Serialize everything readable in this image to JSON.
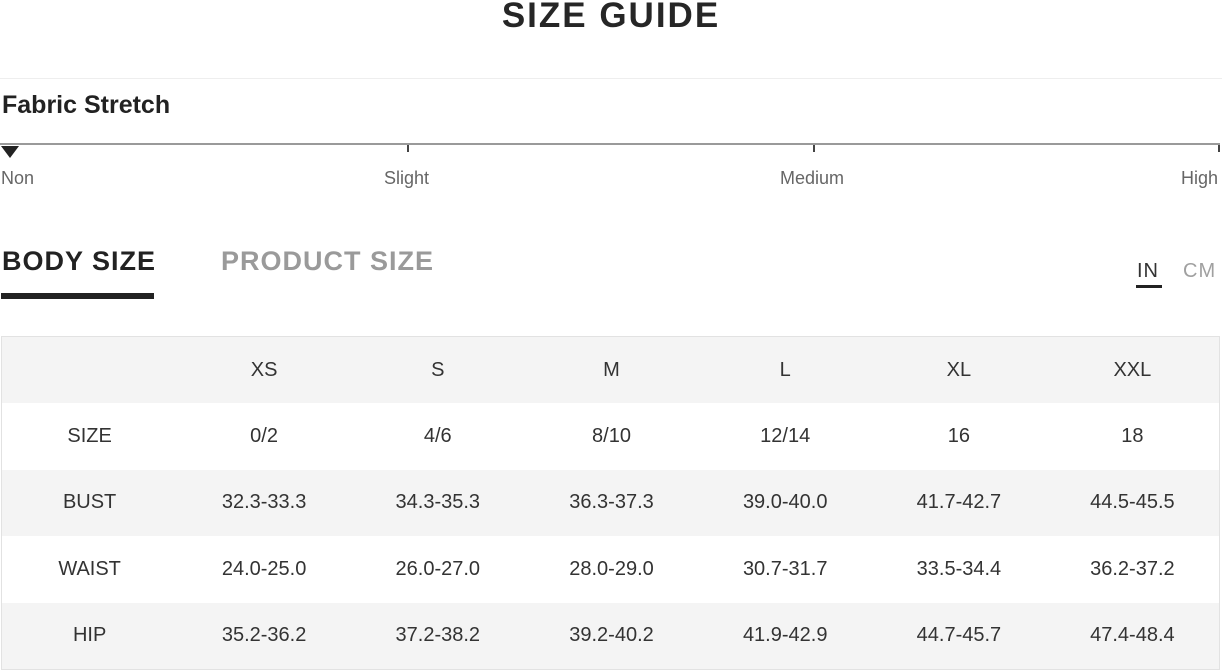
{
  "title": "SIZE GUIDE",
  "fabric_stretch": {
    "heading": "Fabric Stretch",
    "levels": [
      "Non",
      "Slight",
      "Medium",
      "High"
    ],
    "selected": "Non"
  },
  "tabs": {
    "body_size": "BODY SIZE",
    "product_size": "PRODUCT SIZE",
    "active": "BODY SIZE"
  },
  "units": {
    "in": "IN",
    "cm": "CM",
    "active": "IN"
  },
  "table": {
    "columns": [
      "",
      "XS",
      "S",
      "M",
      "L",
      "XL",
      "XXL"
    ],
    "rows": [
      [
        "SIZE",
        "0/2",
        "4/6",
        "8/10",
        "12/14",
        "16",
        "18"
      ],
      [
        "BUST",
        "32.3-33.3",
        "34.3-35.3",
        "36.3-37.3",
        "39.0-40.0",
        "41.7-42.7",
        "44.5-45.5"
      ],
      [
        "WAIST",
        "24.0-25.0",
        "26.0-27.0",
        "28.0-29.0",
        "30.7-31.7",
        "33.5-34.4",
        "36.2-37.2"
      ],
      [
        "HIP",
        "35.2-36.2",
        "37.2-38.2",
        "39.2-40.2",
        "41.9-42.9",
        "44.7-45.7",
        "47.4-48.4"
      ]
    ]
  }
}
